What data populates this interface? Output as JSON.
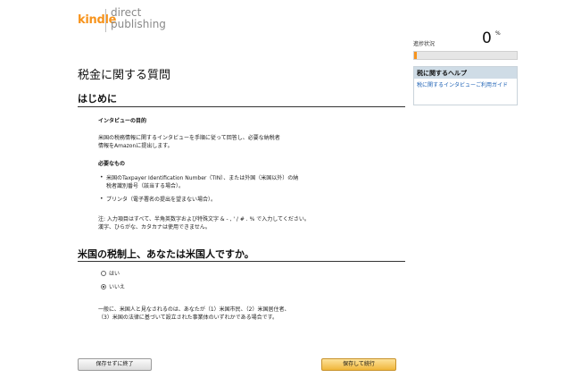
{
  "logo": {
    "kindle": "kindle",
    "direct": "direct",
    "publishing": "publishing"
  },
  "page_title": "税金に関する質問",
  "intro": {
    "heading": "はじめに",
    "purpose_heading": "インタビューの目的",
    "purpose_line1": "米国の税務情報に関するインタビューを手順に従って回答し、必要な納税者",
    "purpose_line2": "情報をAmazonに提出します。",
    "needs_heading": "必要なもの",
    "need1_line1": "米国のTaxpayer Identification Number（TIN）、または外国（米国以外）の納",
    "need1_line2": "税者識別番号（該当する場合）。",
    "need2": "プリンタ（電子署名の提出を望まない場合）。",
    "note_line1": "注: 入力項目はすべて、半角英数字および特殊文字 & - , ' / # . % で入力してください。",
    "note_line2": "漢字、ひらがな、カタカナは使用できません。"
  },
  "question": {
    "heading": "米国の税制上、あなたは米国人ですか。",
    "options": [
      {
        "label": "はい",
        "selected": false
      },
      {
        "label": "いいえ",
        "selected": true
      }
    ],
    "explain_line1": "一般に、米国人と見なされるのは、あなたが（1）米国市民、（2）米国居住者、",
    "explain_line2": "（3）米国の法律に基づいて設立された事業体のいずれかである場合です。"
  },
  "sidebar": {
    "progress_label": "進捗状況",
    "progress_value": "0",
    "progress_unit": "%",
    "progress_fraction": 0.02,
    "help_heading": "税に関するヘルプ",
    "help_link": "税に関するインタビューご利用ガイド"
  },
  "buttons": {
    "exit_label": "保存せずに終了",
    "continue_label": "保存して続行"
  },
  "colors": {
    "brand_orange": "#f7941d",
    "link_blue": "#1a5fb4",
    "help_header_bg": "#cfdce6",
    "primary_button": "#f0b63a"
  }
}
